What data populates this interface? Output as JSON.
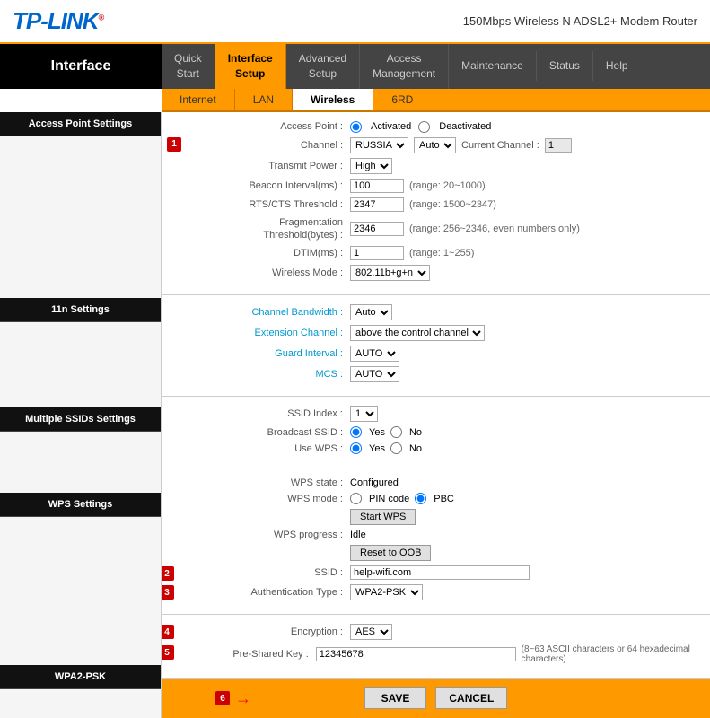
{
  "header": {
    "logo": "TP-LINK",
    "logo_reg": "®",
    "device_name": "150Mbps Wireless N ADSL2+ Modem Router"
  },
  "nav": {
    "sidebar_label": "Interface",
    "items": [
      {
        "label": "Quick\nStart",
        "active": false
      },
      {
        "label": "Interface\nSetup",
        "active": true
      },
      {
        "label": "Advanced\nSetup",
        "active": false
      },
      {
        "label": "Access\nManagement",
        "active": false
      },
      {
        "label": "Maintenance",
        "active": false
      },
      {
        "label": "Status",
        "active": false
      },
      {
        "label": "Help",
        "active": false
      }
    ]
  },
  "subnav": {
    "items": [
      {
        "label": "Internet",
        "active": false
      },
      {
        "label": "LAN",
        "active": false
      },
      {
        "label": "Wireless",
        "active": true
      },
      {
        "label": "6RD",
        "active": false
      }
    ]
  },
  "sections": {
    "access_point": {
      "title": "Access Point Settings",
      "fields": {
        "access_point_label": "Access Point :",
        "activated": "Activated",
        "deactivated": "Deactivated",
        "channel_label": "Channel :",
        "channel_value": "RUSSIA",
        "channel_auto": "Auto",
        "current_channel_label": "Current Channel :",
        "current_channel_value": "1",
        "transmit_power_label": "Transmit Power :",
        "transmit_power_value": "High",
        "beacon_label": "Beacon Interval(ms) :",
        "beacon_value": "100",
        "beacon_range": "(range: 20~1000)",
        "rts_label": "RTS/CTS Threshold :",
        "rts_value": "2347",
        "rts_range": "(range: 1500~2347)",
        "frag_label": "Fragmentation\nThreshold(bytes) :",
        "frag_value": "2346",
        "frag_range": "(range: 256~2346, even numbers only)",
        "dtim_label": "DTIM(ms) :",
        "dtim_value": "1",
        "dtim_range": "(range: 1~255)",
        "wireless_mode_label": "Wireless Mode :",
        "wireless_mode_value": "802.11b+g+n"
      }
    },
    "settings_11n": {
      "title": "11n Settings",
      "fields": {
        "channel_bw_label": "Channel Bandwidth :",
        "channel_bw_value": "Auto",
        "extension_ch_label": "Extension Channel :",
        "extension_ch_value": "above the control channel",
        "guard_interval_label": "Guard Interval :",
        "guard_interval_value": "AUTO",
        "mcs_label": "MCS :",
        "mcs_value": "AUTO"
      }
    },
    "multiple_ssids": {
      "title": "Multiple SSIDs Settings",
      "fields": {
        "ssid_index_label": "SSID Index :",
        "ssid_index_value": "1",
        "broadcast_ssid_label": "Broadcast SSID :",
        "broadcast_yes": "Yes",
        "broadcast_no": "No",
        "use_wps_label": "Use WPS :",
        "wps_yes": "Yes",
        "wps_no": "No"
      }
    },
    "wps": {
      "title": "WPS Settings",
      "fields": {
        "wps_state_label": "WPS state :",
        "wps_state_value": "Configured",
        "wps_mode_label": "WPS mode :",
        "pin_code": "PIN code",
        "pbc": "PBC",
        "start_wps_btn": "Start WPS",
        "wps_progress_label": "WPS progress :",
        "wps_progress_value": "Idle",
        "reset_oob_btn": "Reset to OOB",
        "ssid_label": "SSID :",
        "ssid_value": "help-wifi.com",
        "auth_type_label": "Authentication Type :",
        "auth_type_value": "WPA2-PSK"
      }
    },
    "wpa2_psk": {
      "title": "WPA2-PSK",
      "fields": {
        "encryption_label": "Encryption :",
        "encryption_value": "AES",
        "pre_shared_label": "Pre-Shared Key :",
        "pre_shared_value": "12345678",
        "pre_shared_hint": "(8~63 ASCII characters or 64 hexadecimal characters)"
      }
    }
  },
  "footer": {
    "save_label": "SAVE",
    "cancel_label": "CANCEL"
  },
  "annotations": {
    "1": "1",
    "2": "2",
    "3": "3",
    "4": "4",
    "5": "5",
    "6": "6"
  }
}
